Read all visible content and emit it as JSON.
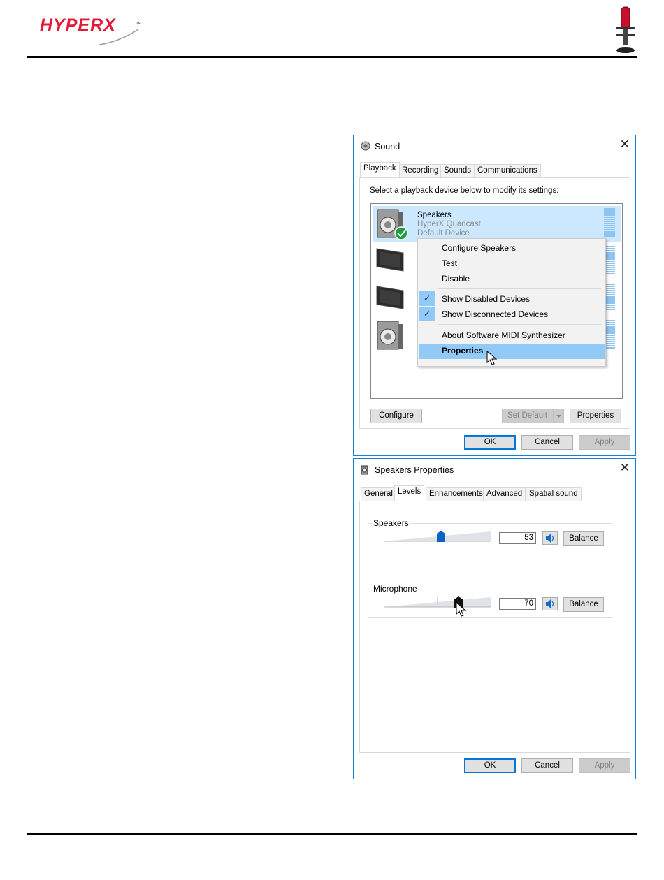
{
  "brand": {
    "logo_text": "HYPERX",
    "trademark": "™",
    "accent_color": "#e31937",
    "mic_image": "microphone-icon"
  },
  "sound_dialog": {
    "title": "Sound",
    "close": "✕",
    "tabs": [
      "Playback",
      "Recording",
      "Sounds",
      "Communications"
    ],
    "active_tab": "Playback",
    "instruction": "Select a playback device below to modify its settings:",
    "devices": [
      {
        "name": "Speakers",
        "detail1": "HyperX Quadcast",
        "detail2": "Default Device",
        "icon": "speaker-icon",
        "selected": true,
        "default": true
      },
      {
        "icon": "monitor-icon"
      },
      {
        "icon": "monitor-icon"
      },
      {
        "icon": "speaker-icon"
      }
    ],
    "context_menu": {
      "items": [
        {
          "label": "Configure Speakers"
        },
        {
          "label": "Test"
        },
        {
          "label": "Disable"
        },
        {
          "label": "Show Disabled Devices",
          "checked": true
        },
        {
          "label": "Show Disconnected Devices",
          "checked": true
        },
        {
          "label": "About Software MIDI Synthesizer"
        },
        {
          "label": "Properties",
          "highlighted": true
        }
      ],
      "check_glyph": "✓"
    },
    "buttons": {
      "configure": "Configure",
      "set_default": "Set Default",
      "properties": "Properties",
      "ok": "OK",
      "cancel": "Cancel",
      "apply": "Apply"
    }
  },
  "speakers_properties": {
    "title": "Speakers Properties",
    "close": "✕",
    "tabs": [
      "General",
      "Levels",
      "Enhancements",
      "Advanced",
      "Spatial sound"
    ],
    "active_tab": "Levels",
    "levels": [
      {
        "label": "Speakers",
        "value": "53",
        "level": 0.53,
        "balance": "Balance"
      },
      {
        "label": "Microphone",
        "value": "70",
        "level": 0.7,
        "balance": "Balance"
      }
    ],
    "buttons": {
      "ok": "OK",
      "cancel": "Cancel",
      "apply": "Apply"
    }
  }
}
